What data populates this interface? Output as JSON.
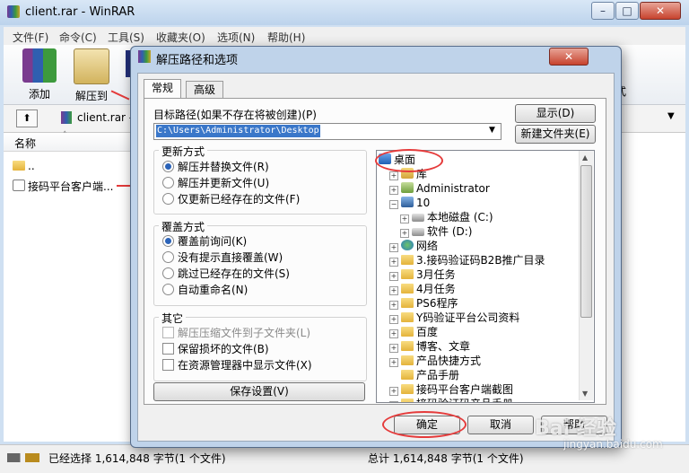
{
  "main": {
    "title": "client.rar - WinRAR",
    "caption_buttons": [
      "–",
      "□",
      "✕"
    ],
    "menu": [
      "文件(F)",
      "命令(C)",
      "工具(S)",
      "收藏夹(O)",
      "选项(N)",
      "帮助(H)"
    ],
    "toolbar": [
      {
        "label": "添加",
        "icon": "archive-add-icon"
      },
      {
        "label": "解压到",
        "icon": "extract-to-icon"
      }
    ],
    "toolbar_partial_right": "式",
    "address": "client.rar -",
    "column_name": "名称",
    "files": [
      {
        "name": "..",
        "icon": "folder-icon"
      },
      {
        "name": "接码平台客户端...",
        "icon": "file-icon"
      }
    ],
    "status_left": "已经选择 1,614,848 字节(1 个文件)",
    "status_right": "总计 1,614,848 字节(1 个文件)"
  },
  "dialog": {
    "title": "解压路径和选项",
    "close_label": "✕",
    "tabs": [
      "常规",
      "高级"
    ],
    "path_label": "目标路径(如果不存在将被创建)(P)",
    "path_value": "C:\\Users\\Administrator\\Desktop",
    "show_button": "显示(D)",
    "new_folder_button": "新建文件夹(E)",
    "update_mode": {
      "title": "更新方式",
      "options": [
        "解压并替换文件(R)",
        "解压并更新文件(U)",
        "仅更新已经存在的文件(F)"
      ],
      "selected": 0
    },
    "overwrite_mode": {
      "title": "覆盖方式",
      "options": [
        "覆盖前询问(K)",
        "没有提示直接覆盖(W)",
        "跳过已经存在的文件(S)",
        "自动重命名(N)"
      ],
      "selected": 0
    },
    "misc": {
      "title": "其它",
      "options": [
        "解压压缩文件到子文件夹(L)",
        "保留损坏的文件(B)",
        "在资源管理器中显示文件(X)"
      ],
      "disabled": [
        true,
        false,
        false
      ]
    },
    "save_settings": "保存设置(V)",
    "tree": [
      {
        "label": "桌面",
        "icon": "desktop-icon",
        "depth": 0,
        "expander": ""
      },
      {
        "label": "库",
        "icon": "library-icon",
        "depth": 1,
        "expander": "+"
      },
      {
        "label": "Administrator",
        "icon": "user-icon",
        "depth": 1,
        "expander": "+"
      },
      {
        "label": "10",
        "icon": "computer-icon",
        "depth": 1,
        "expander": "−"
      },
      {
        "label": "本地磁盘 (C:)",
        "icon": "drive-icon",
        "depth": 2,
        "expander": "+"
      },
      {
        "label": "软件 (D:)",
        "icon": "drive-icon",
        "depth": 2,
        "expander": "+"
      },
      {
        "label": "网络",
        "icon": "network-icon",
        "depth": 1,
        "expander": "+"
      },
      {
        "label": "3.接码验证码B2B推广目录",
        "icon": "folder-icon",
        "depth": 1,
        "expander": "+"
      },
      {
        "label": "3月任务",
        "icon": "folder-icon",
        "depth": 1,
        "expander": "+"
      },
      {
        "label": "4月任务",
        "icon": "folder-icon",
        "depth": 1,
        "expander": "+"
      },
      {
        "label": "PS6程序",
        "icon": "folder-icon",
        "depth": 1,
        "expander": "+"
      },
      {
        "label": "Y码验证平台公司资料",
        "icon": "folder-icon",
        "depth": 1,
        "expander": "+"
      },
      {
        "label": "百度",
        "icon": "folder-icon",
        "depth": 1,
        "expander": "+"
      },
      {
        "label": "博客、文章",
        "icon": "folder-icon",
        "depth": 1,
        "expander": "+"
      },
      {
        "label": "产品快捷方式",
        "icon": "folder-icon",
        "depth": 1,
        "expander": "+"
      },
      {
        "label": "产品手册",
        "icon": "folder-icon",
        "depth": 1,
        "expander": ""
      },
      {
        "label": "接码平台客户端截图",
        "icon": "folder-icon",
        "depth": 1,
        "expander": "+"
      },
      {
        "label": "接码验证码产品手册",
        "icon": "folder-icon",
        "depth": 1,
        "expander": "+"
      }
    ],
    "ok": "确定",
    "cancel": "取消",
    "help": "帮助"
  },
  "watermark": {
    "site": "jingyan.baidu.com",
    "brand": "Bai 经验"
  }
}
